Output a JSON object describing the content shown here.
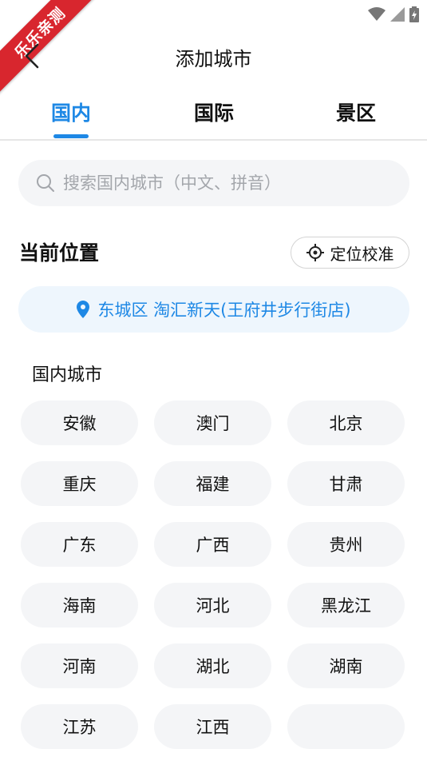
{
  "watermark": "乐乐亲测",
  "header": {
    "title": "添加城市"
  },
  "tabs": [
    {
      "label": "国内",
      "active": true
    },
    {
      "label": "国际",
      "active": false
    },
    {
      "label": "景区",
      "active": false
    }
  ],
  "search": {
    "placeholder": "搜索国内城市（中文、拼音）"
  },
  "current_location": {
    "title": "当前位置",
    "locate_button": "定位校准",
    "address": "东城区 淘汇新天(王府井步行街店)"
  },
  "domestic": {
    "title": "国内城市",
    "cities": [
      "安徽",
      "澳门",
      "北京",
      "重庆",
      "福建",
      "甘肃",
      "广东",
      "广西",
      "贵州",
      "海南",
      "河北",
      "黑龙江",
      "河南",
      "湖北",
      "湖南",
      "江苏",
      "江西",
      ""
    ]
  },
  "colors": {
    "accent": "#1e88e5",
    "chip_bg": "#f4f5f7",
    "location_bg": "#eef6fd",
    "watermark_bg": "#d8262e"
  },
  "icons": [
    "wifi-icon",
    "signal-icon",
    "battery-icon",
    "back-arrow-icon",
    "search-icon",
    "locate-target-icon",
    "location-pin-icon"
  ]
}
